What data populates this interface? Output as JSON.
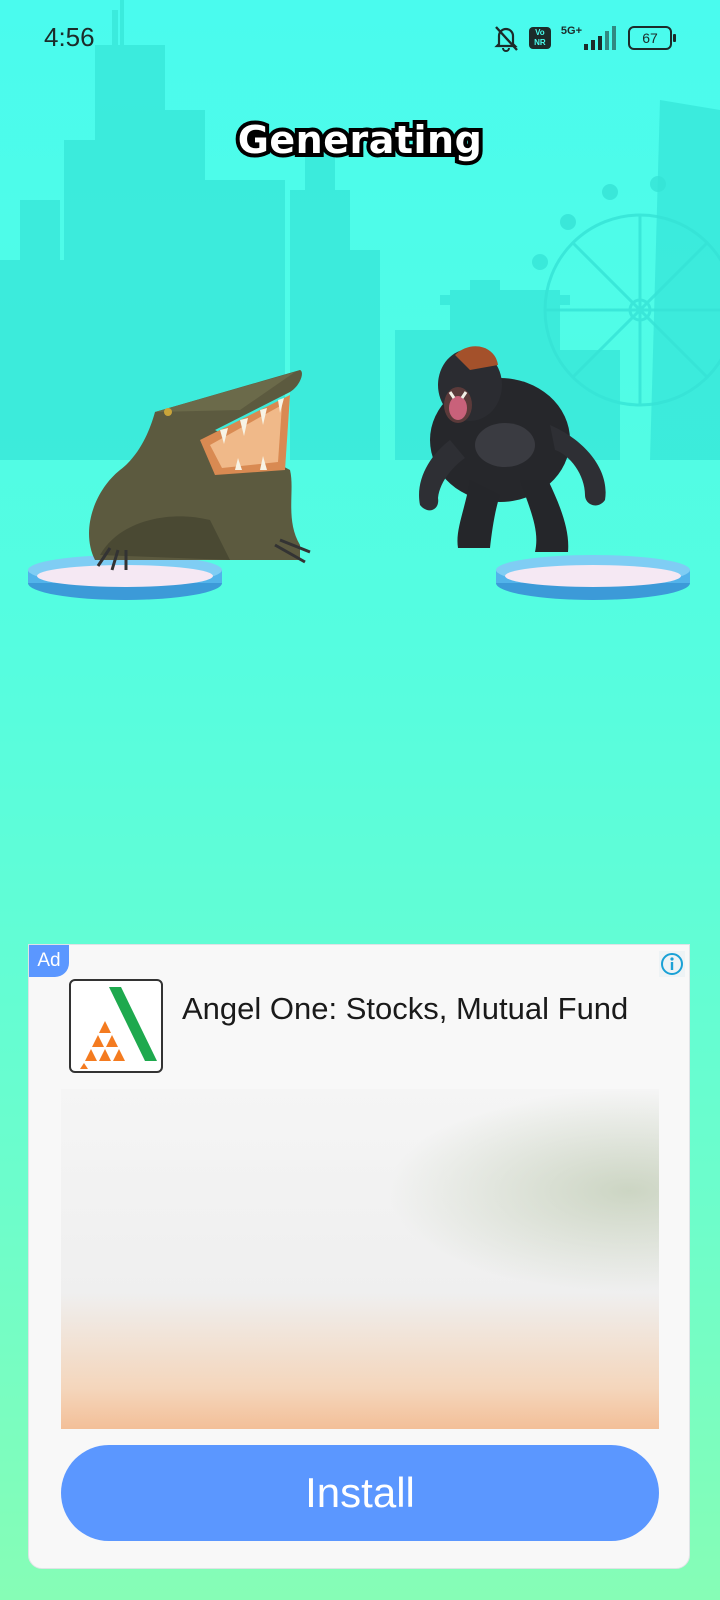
{
  "status_bar": {
    "time": "4:56",
    "network_label": "5G+",
    "vonr_label_top": "Vo",
    "vonr_label_bottom": "NR",
    "battery": "67",
    "icons": [
      "bell-muted-icon",
      "vonr-icon",
      "signal-icon",
      "battery-icon"
    ]
  },
  "game": {
    "title": "Generating",
    "fighters": [
      {
        "name_icon": "crocodile"
      },
      {
        "name_icon": "gorilla"
      }
    ]
  },
  "ad": {
    "badge": "Ad",
    "app_name": "Angel One: Stocks, Mutual Fund",
    "install_label": "Install",
    "accent_color": "#5b97ff"
  },
  "colors": {
    "bg_top": "#4afbee",
    "bg_bottom": "#86fdb6",
    "skyline": "#36e3d6"
  }
}
